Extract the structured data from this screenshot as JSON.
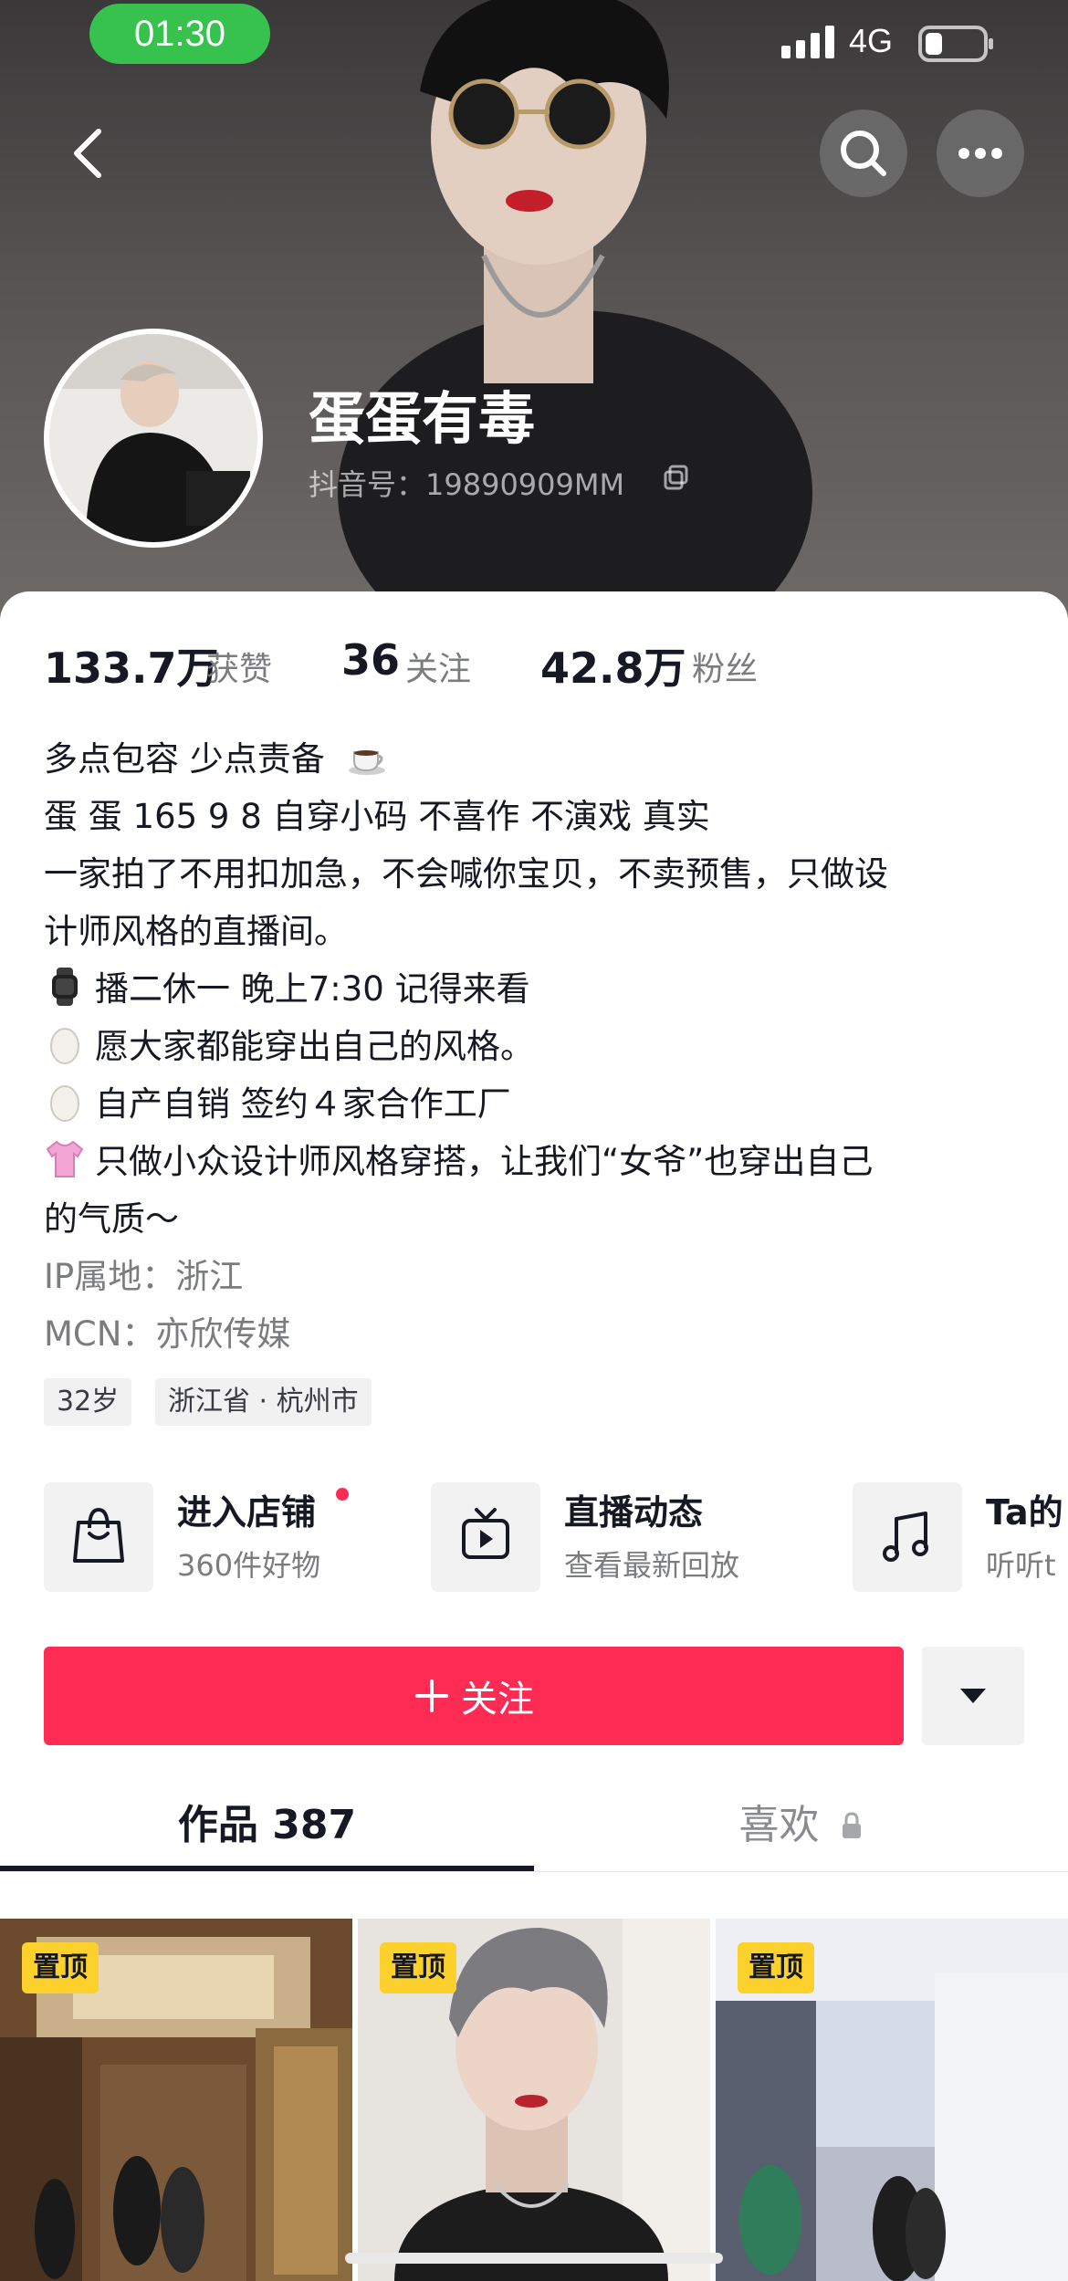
{
  "status_bar": {
    "time": "01:30",
    "network": "4G"
  },
  "profile": {
    "nickname": "蛋蛋有毒",
    "account_id": "抖音号：19890909MM"
  },
  "stats": [
    {
      "value": "133.7万",
      "label": "获赞"
    },
    {
      "value": "36",
      "label": "关注"
    },
    {
      "value": "42.8万",
      "label": "粉丝"
    }
  ],
  "bio": {
    "line1": "多点包容 少点责备",
    "line2": "蛋 蛋 165    9 8 自穿小码 不喜作 不演戏 真实",
    "line3": "一家拍了不用扣加急，不会喊你宝贝，不卖预售，只做设",
    "line4": "计师风格的直播间。",
    "line5": "播二休一 晚上7:30 记得来看",
    "line6": "愿大家都能穿出自己的风格。",
    "line7": "自产自销 签约４家合作工厂",
    "line8": "只做小众设计师风格穿搭，让我们“女爷”也穿出自己",
    "line9": "的气质～",
    "ip": "IP属地：浙江",
    "mcn": "MCN：亦欣传媒"
  },
  "tags": [
    "32岁",
    "浙江省 · 杭州市"
  ],
  "entries": [
    {
      "title": "进入店铺",
      "subtitle": "360件好物",
      "icon": "shopping-bag-icon"
    },
    {
      "title": "直播动态",
      "subtitle": "查看最新回放",
      "icon": "live-tv-icon"
    },
    {
      "title": "Ta的",
      "subtitle": "听听t",
      "icon": "music-note-icon"
    }
  ],
  "actions": {
    "follow_label": "关注"
  },
  "tabs": [
    {
      "label": "作品 387",
      "active": true
    },
    {
      "label": "喜欢",
      "active": false
    }
  ],
  "videos": [
    {
      "badge": "置顶"
    },
    {
      "badge": "置顶"
    },
    {
      "badge": "置顶"
    }
  ],
  "colors": {
    "accent": "#fe2c55",
    "pin_badge": "#fcd12b",
    "status_time_bg": "#37c24e"
  }
}
